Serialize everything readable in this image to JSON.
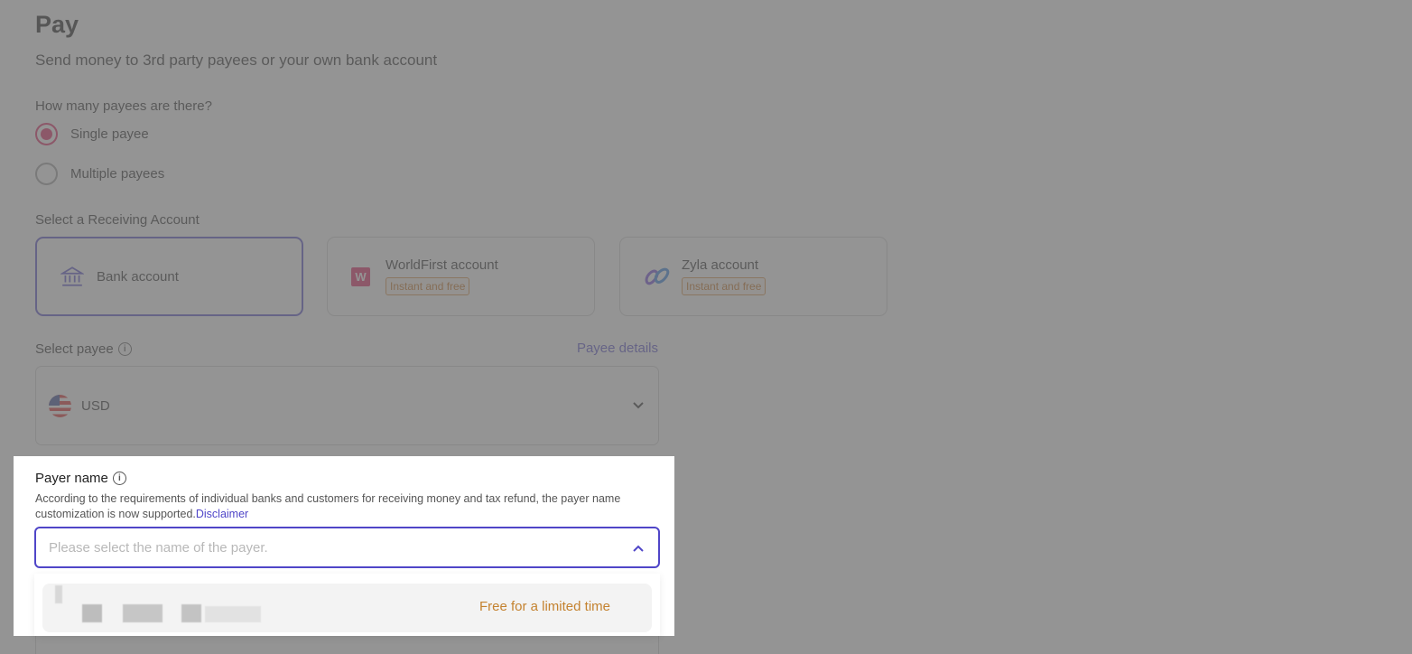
{
  "header": {
    "title": "Pay",
    "subtitle": "Send money to 3rd party payees or your own bank account"
  },
  "payees_question": {
    "label": "How many payees are there?",
    "options": [
      {
        "label": "Single payee",
        "selected": true
      },
      {
        "label": "Multiple payees",
        "selected": false
      }
    ]
  },
  "receiving_account": {
    "label": "Select a Receiving Account",
    "cards": [
      {
        "label": "Bank account",
        "icon": "bank-icon",
        "selected": true
      },
      {
        "label": "WorldFirst account",
        "icon": "worldfirst-logo-icon",
        "badge": "Instant and free",
        "icon_letter": "W"
      },
      {
        "label": "Zyla account",
        "icon": "zyla-logo-icon",
        "badge": "Instant and free"
      }
    ]
  },
  "payee": {
    "label": "Select payee",
    "details_link": "Payee details",
    "selected_currency": "USD"
  },
  "payer": {
    "label": "Payer name",
    "description": "According to the requirements of individual banks and customers for receiving money and tax refund, the payer name customization is now supported.",
    "disclaimer_link": "Disclaimer",
    "placeholder": "Please select the name of the payer.",
    "dropdown_option_tag": "Free for a limited time"
  },
  "colors": {
    "accent": "#5046c8",
    "radio_selected": "#e0195b",
    "badge": "#c46a12",
    "overlay": "rgba(110,110,110,0.74)"
  }
}
